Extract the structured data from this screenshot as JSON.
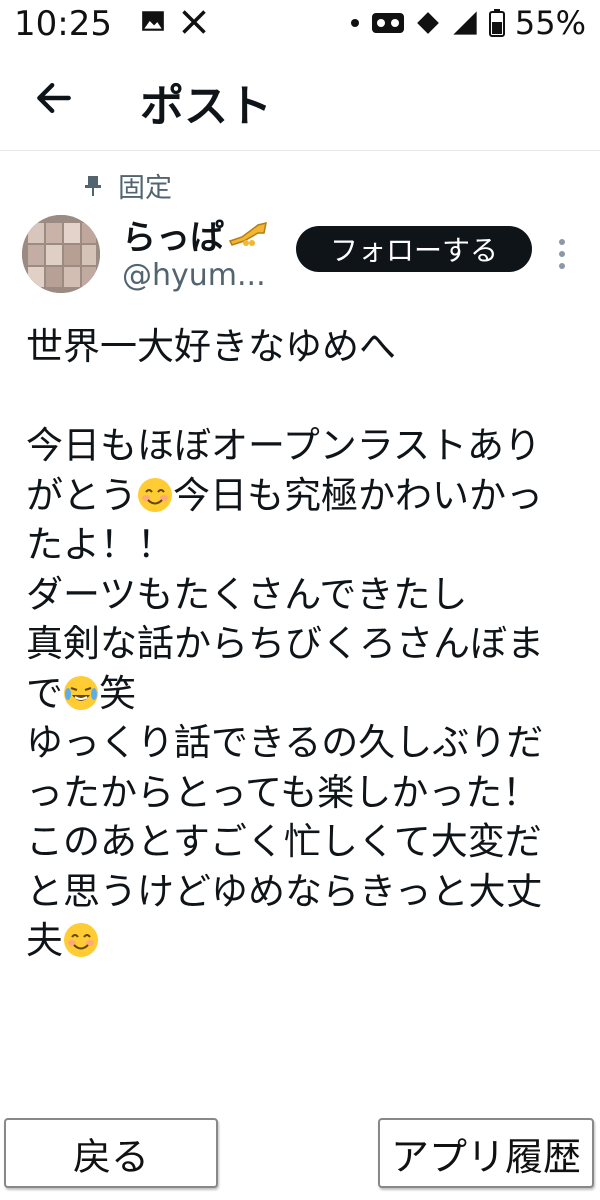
{
  "status_bar": {
    "time": "10:25",
    "battery_percent": "55%",
    "icons": [
      "image-icon",
      "x-logo-icon",
      "dot-icon",
      "voicemail-icon",
      "vpn-key-icon",
      "signal-icon",
      "battery-icon"
    ]
  },
  "header": {
    "back_icon": "back-arrow-icon",
    "title": "ポスト"
  },
  "post": {
    "pinned_label": "固定",
    "pin_icon": "pin-icon",
    "author": {
      "display_name": "らっぱ",
      "name_emoji": "trumpet-emoji",
      "handle": "@hyum..."
    },
    "follow_label": "フォローする",
    "more_icon": "more-vertical-icon",
    "text_segments": [
      "世界一大好きなゆめへ\n\n今日もほぼオープンラストありがとう",
      "今日も究極かわいかったよ！！\nダーツもたくさんできたし\n真剣な話からちびくろさんぼまで",
      "笑\nゆっくり話できるの久しぶりだったからとっても楽しかった！\nこのあとすごく忙しくて大変だと思うけどゆめならきっと大丈夫",
      ""
    ],
    "emojis": [
      "smiling-face-emoji",
      "tears-of-joy-emoji",
      "smiling-face-emoji"
    ]
  },
  "bottom_nav": {
    "back_label": "戻る",
    "history_label": "アプリ履歴"
  },
  "colors": {
    "text": "#0f1419",
    "secondary": "#536471",
    "button_bg": "#0f1419",
    "emoji_yellow": "#ffcc33"
  }
}
